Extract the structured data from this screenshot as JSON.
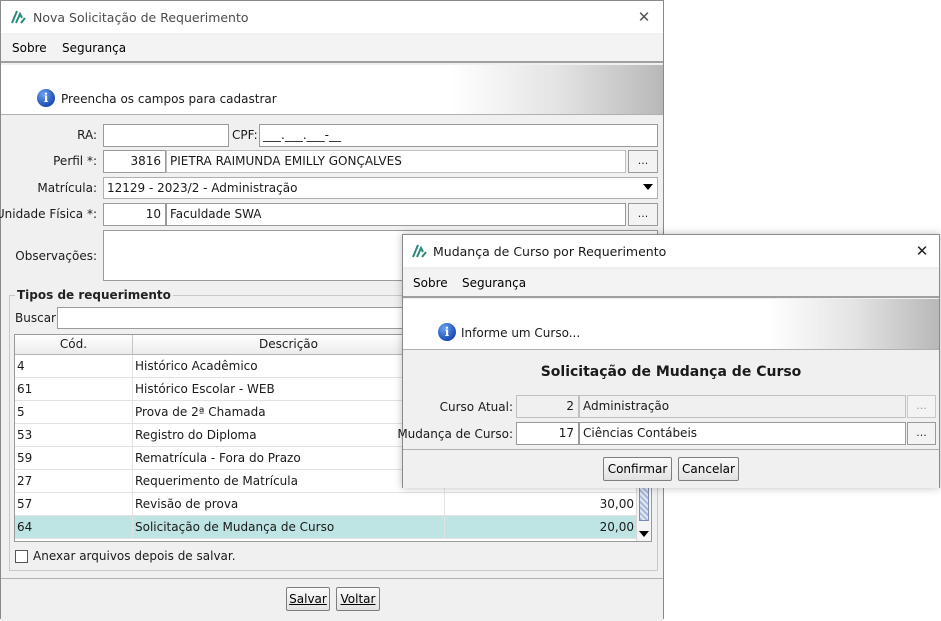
{
  "main": {
    "title": "Nova Solicitação de Requerimento",
    "menu": [
      "Sobre",
      "Segurança"
    ],
    "banner_text": "Preencha os campos para cadastrar",
    "form": {
      "ra_label": "RA:",
      "ra_value": "",
      "cpf_label": "CPF:",
      "cpf_value": "___.___.___-__",
      "perfil_label": "Perfil *:",
      "perfil_code": "3816",
      "perfil_name": "PIETRA RAIMUNDA EMILLY GONÇALVES",
      "matricula_label": "Matrícula:",
      "matricula_value": "12129 - 2023/2 - Administração",
      "unidade_label": "Unidade Física *:",
      "unidade_code": "10",
      "unidade_name": "Faculdade SWA",
      "obs_label": "Observações:",
      "obs_value": "",
      "dots": "..."
    },
    "tipos": {
      "title": "Tipos de requerimento",
      "buscar_label": "Buscar:",
      "buscar_value": "",
      "columns": [
        "Cód.",
        "Descrição"
      ],
      "rows": [
        {
          "cod": "4",
          "desc": "Histórico Acadêmico",
          "valor": ""
        },
        {
          "cod": "61",
          "desc": "Histórico Escolar - WEB",
          "valor": ""
        },
        {
          "cod": "5",
          "desc": "Prova de 2ª Chamada",
          "valor": ""
        },
        {
          "cod": "53",
          "desc": "Registro do Diploma",
          "valor": ""
        },
        {
          "cod": "59",
          "desc": "Rematrícula - Fora do Prazo",
          "valor": ""
        },
        {
          "cod": "27",
          "desc": "Requerimento de Matrícula",
          "valor": ""
        },
        {
          "cod": "57",
          "desc": "Revisão de prova",
          "valor": "30,00"
        },
        {
          "cod": "64",
          "desc": "Solicitação de Mudança de Curso",
          "valor": "20,00"
        }
      ]
    },
    "anexar_label": "Anexar arquivos depois de salvar.",
    "salvar_label": "Salvar",
    "voltar_label": "Voltar"
  },
  "dialog": {
    "title": "Mudança de Curso por Requerimento",
    "menu": [
      "Sobre",
      "Segurança"
    ],
    "banner_text": "Informe um Curso...",
    "heading": "Solicitação de Mudança de Curso",
    "curso_atual_label": "Curso Atual:",
    "curso_atual_code": "2",
    "curso_atual_name": "Administração",
    "mudanca_label": "Mudança de Curso:",
    "mudanca_code": "17",
    "mudanca_name": "Ciências Contábeis",
    "dots": "...",
    "confirmar_label": "Confirmar",
    "cancelar_label": "Cancelar"
  },
  "colors": {
    "selected_row": "#bfe4e4",
    "info_icon": "#1b4fb5",
    "logo": "#2a8a7a"
  }
}
